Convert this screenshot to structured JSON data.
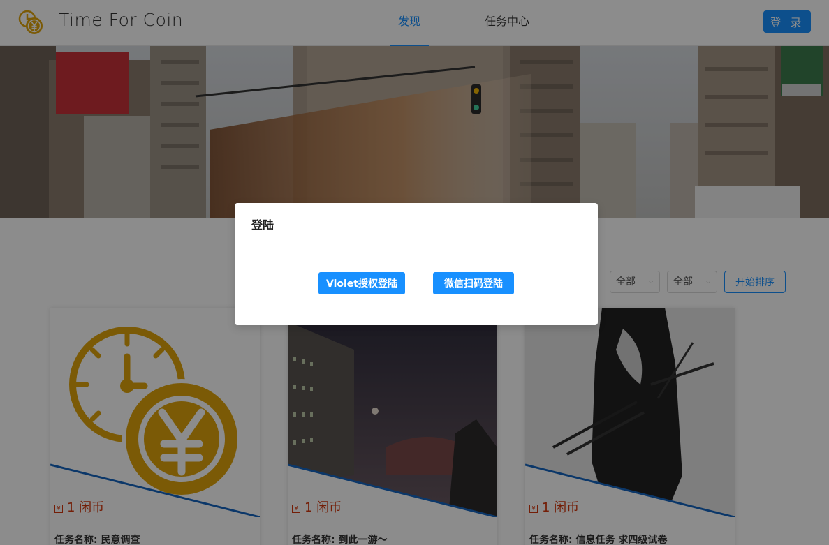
{
  "header": {
    "brand": "Time For Coin",
    "tabs": [
      {
        "label": "发现",
        "active": true
      },
      {
        "label": "任务中心",
        "active": false
      }
    ],
    "login_label": "登 录"
  },
  "filters": {
    "options": [
      {
        "value": "全部"
      },
      {
        "value": "全部"
      }
    ],
    "sort_label": "开始排序"
  },
  "cards": [
    {
      "reward": "1 闲币",
      "task_name": "任务名称: 民意调查",
      "image": "time-coin-logo"
    },
    {
      "reward": "1 闲币",
      "task_name": "任务名称: 到此一游～",
      "image": "campus-night-photo"
    },
    {
      "reward": "1 闲币",
      "task_name": "任务名称: 信息任务 求四级试卷",
      "image": "samurai-photo"
    }
  ],
  "modal": {
    "title": "登陆",
    "buttons": [
      {
        "label": "Violet授权登陆"
      },
      {
        "label": "微信扫码登陆"
      }
    ]
  },
  "colors": {
    "primary": "#1890ff",
    "reward": "#d4380d",
    "logo_gold": "#e0a50c"
  }
}
